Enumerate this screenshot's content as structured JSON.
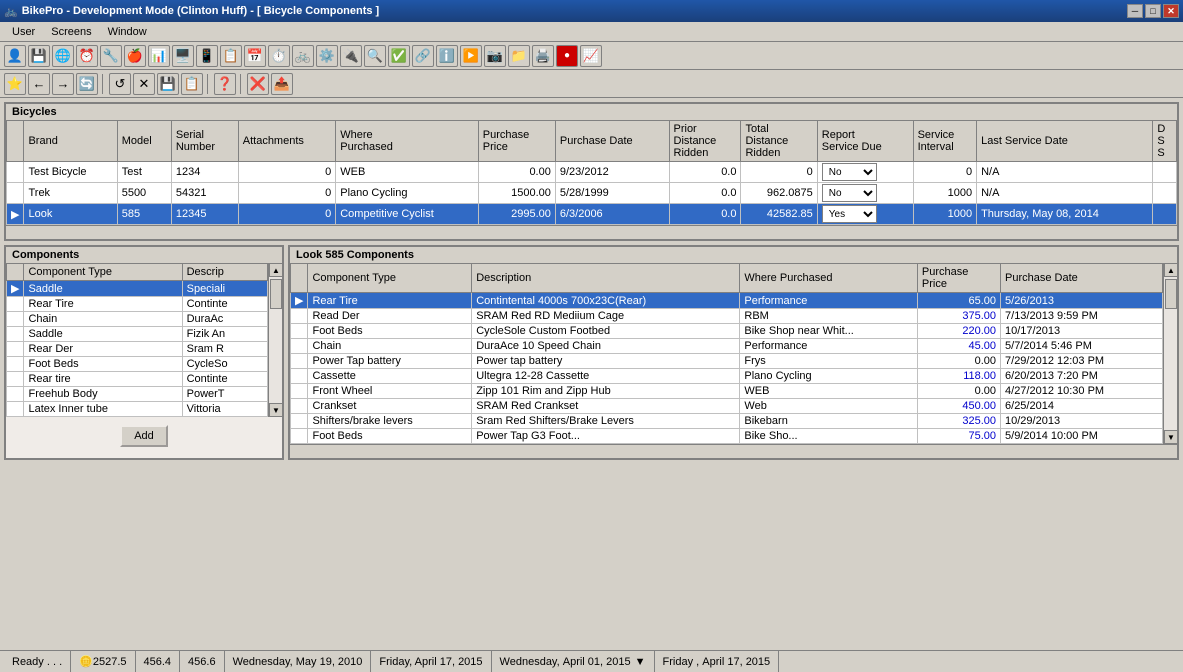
{
  "window": {
    "title": "BikePro - Development Mode (Clinton Huff) - [ Bicycle Components ]",
    "title_icon": "🚲"
  },
  "menu": {
    "items": [
      "User",
      "Screens",
      "Window"
    ]
  },
  "toolbar1": {
    "buttons": [
      "👤",
      "💼",
      "🔵",
      "⏰",
      "🔧",
      "🍎",
      "📊",
      "🖥️",
      "📱",
      "📋",
      "📅",
      "⏱️",
      "🚲",
      "⚙️",
      "🔌",
      "🔴",
      "✅",
      "🔗",
      "ℹ️",
      "▶️",
      "📷",
      "📁",
      "🖨️",
      "🔴",
      "📈"
    ]
  },
  "toolbar2": {
    "buttons": [
      "⭐",
      "↩️",
      "💾",
      "🔄",
      "❌",
      "📋",
      "❓",
      "❌",
      "📤"
    ]
  },
  "bicycles": {
    "section_title": "Bicycles",
    "columns": [
      "Brand",
      "Model",
      "Serial Number",
      "Attachments",
      "Where Purchased",
      "Purchase Price",
      "Purchase Date",
      "Prior Distance Ridden",
      "Total Distance Ridden",
      "Report Service Due",
      "Service Interval",
      "Last Service Date",
      "D S S"
    ],
    "rows": [
      {
        "marker": "",
        "brand": "Test Bicycle",
        "model": "Test",
        "serial": "1234",
        "attachments": "0",
        "where_purchased": "WEB",
        "purchase_price": "0.00",
        "purchase_date": "9/23/2012",
        "prior_dist": "0.0",
        "total_dist": "0",
        "service_due": "No",
        "service_interval": "0",
        "last_service": "N/A",
        "selected": false
      },
      {
        "marker": "",
        "brand": "Trek",
        "model": "5500",
        "serial": "54321",
        "attachments": "0",
        "where_purchased": "Plano Cycling",
        "purchase_price": "1500.00",
        "purchase_date": "5/28/1999",
        "prior_dist": "0.0",
        "total_dist": "962.0875",
        "service_due": "No",
        "service_interval": "1000",
        "last_service": "N/A",
        "selected": false
      },
      {
        "marker": "▶",
        "brand": "Look",
        "model": "585",
        "serial": "12345",
        "attachments": "0",
        "where_purchased": "Competitive Cyclist",
        "purchase_price": "2995.00",
        "purchase_date": "6/3/2006",
        "prior_dist": "0.0",
        "total_dist": "42582.85",
        "service_due": "Yes",
        "service_interval": "1000",
        "last_service": "Thursday, May 08, 2014",
        "selected": true
      }
    ]
  },
  "components": {
    "section_title": "Components",
    "columns": [
      "Component Type",
      "Descrip"
    ],
    "rows": [
      {
        "type": "Saddle",
        "desc": "Speciali",
        "selected": true
      },
      {
        "type": "Rear Tire",
        "desc": "Continte",
        "selected": false
      },
      {
        "type": "Chain",
        "desc": "DuraAc",
        "selected": false
      },
      {
        "type": "Saddle",
        "desc": "Fizik An",
        "selected": false
      },
      {
        "type": "Rear Der",
        "desc": "Sram R",
        "selected": false
      },
      {
        "type": "Foot Beds",
        "desc": "CycleSo",
        "selected": false
      },
      {
        "type": "Rear tire",
        "desc": "Continte",
        "selected": false
      },
      {
        "type": "Freehub Body",
        "desc": "PowerT",
        "selected": false
      },
      {
        "type": "Latex Inner tube",
        "desc": "Vittoria",
        "selected": false
      }
    ],
    "add_button": "Add"
  },
  "look_components": {
    "section_title": "Look 585 Components",
    "columns": [
      "Component Type",
      "Description",
      "Where Purchased",
      "Purchase Price",
      "Purchase Date"
    ],
    "rows": [
      {
        "marker": "▶",
        "type": "Rear Tire",
        "desc": "Contintental 4000s 700x23C(Rear)",
        "where": "Performance",
        "price": "65.00",
        "date": "5/26/2013",
        "selected": true
      },
      {
        "marker": "",
        "type": "Read Der",
        "desc": "SRAM Red RD Mediium Cage",
        "where": "RBM",
        "price": "375.00",
        "date": "7/13/2013 9:59 PM",
        "selected": false
      },
      {
        "marker": "",
        "type": "Foot Beds",
        "desc": "CycleSole Custom Footbed",
        "where": "Bike Shop near Whit...",
        "price": "220.00",
        "date": "10/17/2013",
        "selected": false
      },
      {
        "marker": "",
        "type": "Chain",
        "desc": "DuraAce 10 Speed Chain",
        "where": "Performance",
        "price": "45.00",
        "date": "5/7/2014 5:46 PM",
        "selected": false
      },
      {
        "marker": "",
        "type": "Power Tap battery",
        "desc": "Power tap battery",
        "where": "Frys",
        "price": "0.00",
        "date": "7/29/2012 12:03 PM",
        "selected": false
      },
      {
        "marker": "",
        "type": "Cassette",
        "desc": "Ultegra 12-28 Cassette",
        "where": "Plano Cycling",
        "price": "118.00",
        "date": "6/20/2013 7:20 PM",
        "selected": false
      },
      {
        "marker": "",
        "type": "Front Wheel",
        "desc": "Zipp 101 Rim and Zipp Hub",
        "where": "WEB",
        "price": "0.00",
        "date": "4/27/2012 10:30 PM",
        "selected": false
      },
      {
        "marker": "",
        "type": "Crankset",
        "desc": "SRAM Red Crankset",
        "where": "Web",
        "price": "450.00",
        "date": "6/25/2014",
        "selected": false
      },
      {
        "marker": "",
        "type": "Shifters/brake levers",
        "desc": "Sram Red Shifters/Brake Levers",
        "where": "Bikebarn",
        "price": "325.00",
        "date": "10/29/2013",
        "selected": false
      },
      {
        "marker": "",
        "type": "Foot Beds",
        "desc": "Power Tap G3 Foot...",
        "where": "Bike Sho...",
        "price": "75.00",
        "date": "5/9/2014 10:00 PM",
        "selected": false
      }
    ]
  },
  "status_bar": {
    "status_text": "Ready . . .",
    "coin_icon": "🪙",
    "value1": "2527.5",
    "value2": "456.4",
    "value3": "456.6",
    "date1": "Wednesday, May 19, 2010",
    "date2": "Friday, April 17, 2015",
    "date3_label": "Wednesday,",
    "date3_value": "April    01, 2015",
    "date4_label": "Friday ,",
    "date4_value": "April  17, 2015"
  }
}
